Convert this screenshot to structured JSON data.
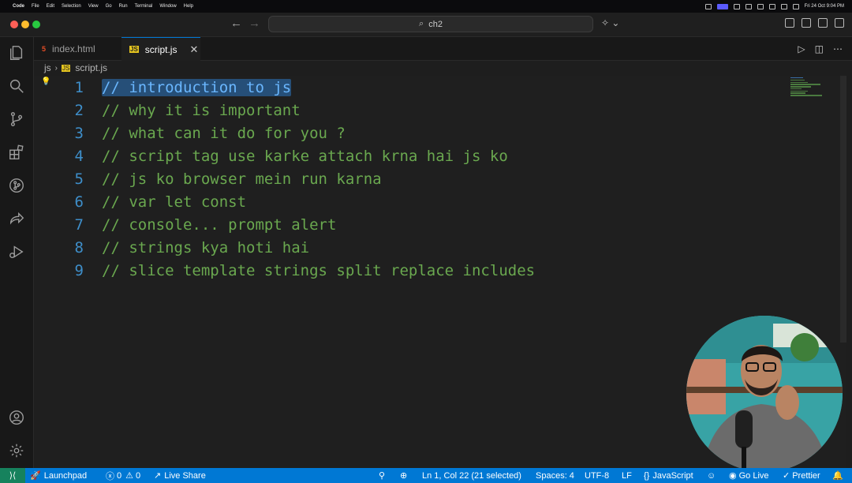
{
  "menubar": {
    "app": "Code",
    "items": [
      "File",
      "Edit",
      "Selection",
      "View",
      "Go",
      "Run",
      "Terminal",
      "Window",
      "Help"
    ],
    "clock": "Fri 24 Oct 9:04 PM"
  },
  "titlebar": {
    "search_text": "ch2"
  },
  "tabs": [
    {
      "label": "index.html",
      "icon": "html-file-icon",
      "active": false
    },
    {
      "label": "script.js",
      "icon": "js-file-icon",
      "active": true
    }
  ],
  "breadcrumb": {
    "folder": "js",
    "file": "script.js"
  },
  "editor": {
    "lines": [
      {
        "num": "1",
        "text": "// introduction to js",
        "selected": true
      },
      {
        "num": "2",
        "text": "// why it is important"
      },
      {
        "num": "3",
        "text": "// what can it do for you ?"
      },
      {
        "num": "4",
        "text": "// script tag use karke attach krna hai js ko"
      },
      {
        "num": "5",
        "text": "// js ko browser mein run karna"
      },
      {
        "num": "6",
        "text": "// var let const"
      },
      {
        "num": "7",
        "text": "// console... prompt alert"
      },
      {
        "num": "8",
        "text": "// strings kya hoti hai"
      },
      {
        "num": "9",
        "text": "// slice template strings split replace includes"
      }
    ]
  },
  "statusbar": {
    "launchpad": "Launchpad",
    "errors": "0",
    "warnings": "0",
    "live_share": "Live Share",
    "position": "Ln 1, Col 22 (21 selected)",
    "spaces": "Spaces: 4",
    "encoding": "UTF-8",
    "eol": "LF",
    "language": "JavaScript",
    "go_live": "Go Live",
    "prettier": "Prettier"
  },
  "colors": {
    "accent": "#0078d4",
    "comment": "#6aa84f",
    "line_number": "#3e8ec9",
    "selection": "#264f78"
  }
}
